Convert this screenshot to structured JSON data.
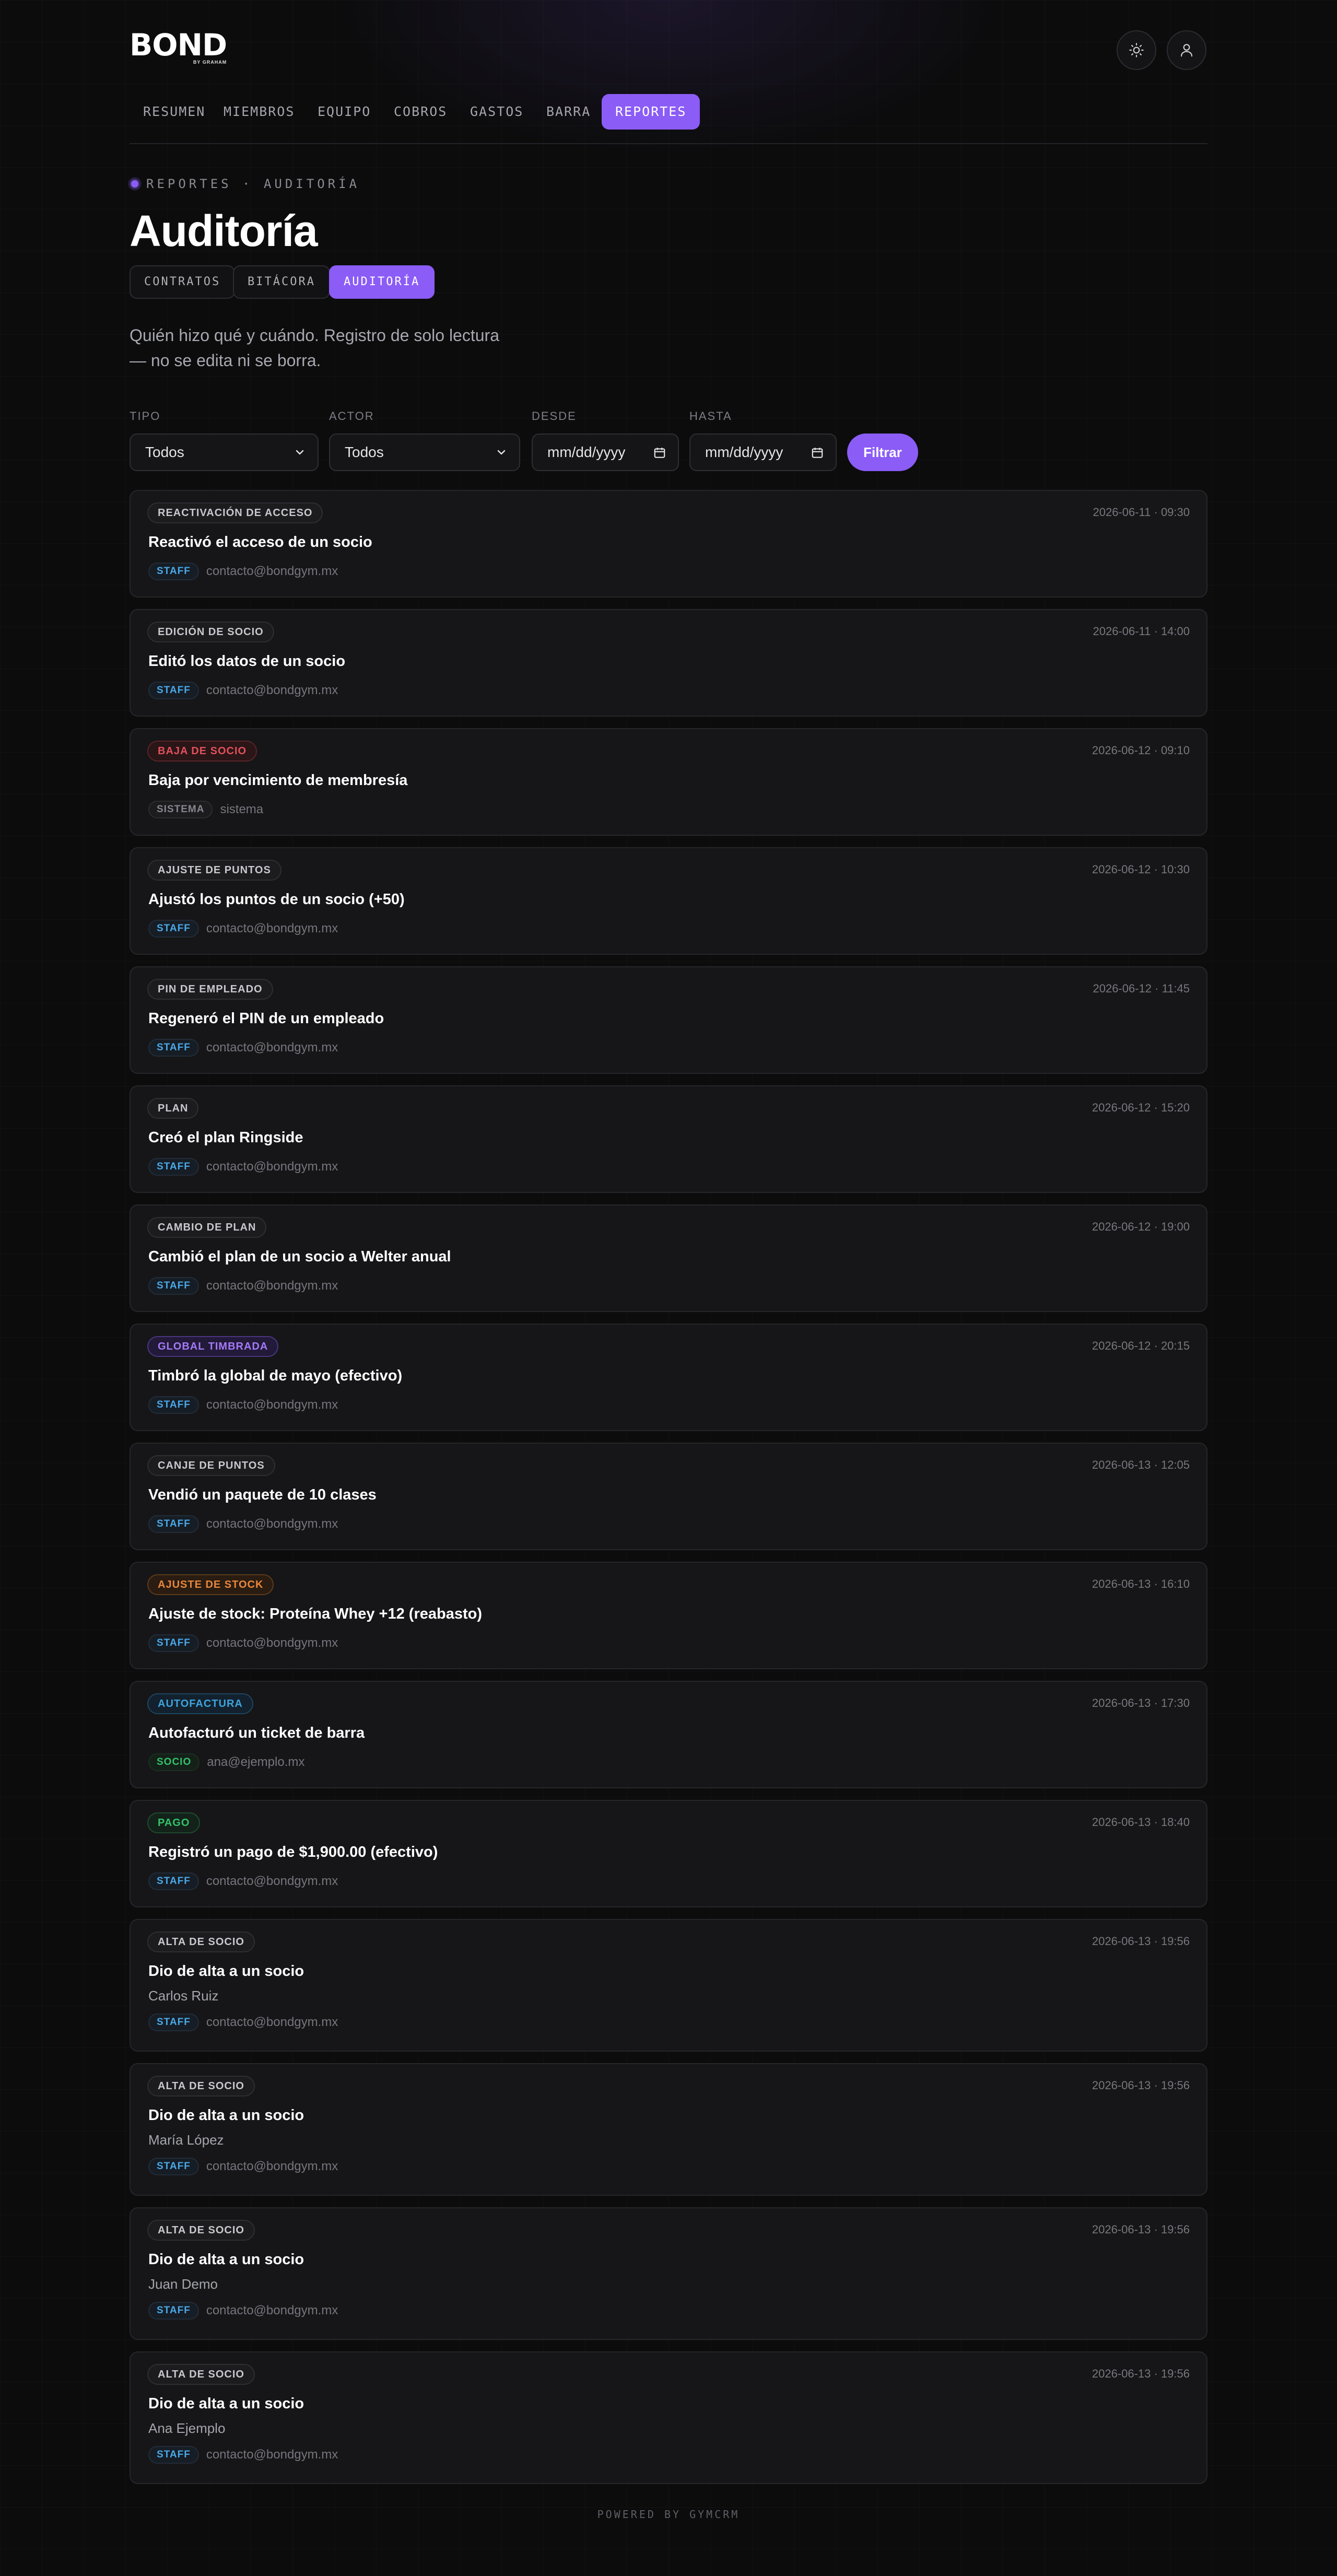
{
  "brand": {
    "logo_text": "BOND",
    "logo_sub": "BY GRAHAM"
  },
  "nav": [
    "RESUMEN",
    "MIEMBROS",
    "EQUIPO",
    "COBROS",
    "GASTOS",
    "BARRA",
    "REPORTES"
  ],
  "nav_active": "REPORTES",
  "breadcrumb": "REPORTES · AUDITORÍA",
  "page_title": "Auditoría",
  "subtabs": [
    "CONTRATOS",
    "BITÁCORA",
    "AUDITORÍA"
  ],
  "subtab_active": "AUDITORÍA",
  "description_line1": "Quién hizo qué y cuándo. Registro de solo lectura",
  "description_line2": "— no se edita ni se borra.",
  "filters": {
    "tipo_label": "TIPO",
    "tipo_value": "Todos",
    "actor_label": "ACTOR",
    "actor_value": "Todos",
    "desde_label": "DESDE",
    "desde_value": "mm/dd/yyyy",
    "hasta_label": "HASTA",
    "hasta_value": "mm/dd/yyyy",
    "button": "Filtrar"
  },
  "badge_colors": {
    "neutral": "#c8c8ce",
    "red": "#e0525c",
    "purple": "#a47af7",
    "orange": "#e8873c",
    "blue": "#3fa3dd",
    "green": "#34c26a"
  },
  "entries": [
    {
      "type": "REACTIVACIÓN DE ACCESO",
      "tone": "neutral",
      "time": "2026-06-11 · 09:30",
      "title": "Reactivó el acceso de un socio",
      "sub": "",
      "role": "STAFF",
      "role_kind": "staff",
      "actor": "contacto@bondgym.mx"
    },
    {
      "type": "EDICIÓN DE SOCIO",
      "tone": "neutral",
      "time": "2026-06-11 · 14:00",
      "title": "Editó los datos de un socio",
      "sub": "",
      "role": "STAFF",
      "role_kind": "staff",
      "actor": "contacto@bondgym.mx"
    },
    {
      "type": "BAJA DE SOCIO",
      "tone": "red",
      "time": "2026-06-12 · 09:10",
      "title": "Baja por vencimiento de membresía",
      "sub": "",
      "role": "SISTEMA",
      "role_kind": "sistema",
      "actor": "sistema"
    },
    {
      "type": "AJUSTE DE PUNTOS",
      "tone": "neutral",
      "time": "2026-06-12 · 10:30",
      "title": "Ajustó los puntos de un socio (+50)",
      "sub": "",
      "role": "STAFF",
      "role_kind": "staff",
      "actor": "contacto@bondgym.mx"
    },
    {
      "type": "PIN DE EMPLEADO",
      "tone": "neutral",
      "time": "2026-06-12 · 11:45",
      "title": "Regeneró el PIN de un empleado",
      "sub": "",
      "role": "STAFF",
      "role_kind": "staff",
      "actor": "contacto@bondgym.mx"
    },
    {
      "type": "PLAN",
      "tone": "neutral",
      "time": "2026-06-12 · 15:20",
      "title": "Creó el plan Ringside",
      "sub": "",
      "role": "STAFF",
      "role_kind": "staff",
      "actor": "contacto@bondgym.mx"
    },
    {
      "type": "CAMBIO DE PLAN",
      "tone": "neutral",
      "time": "2026-06-12 · 19:00",
      "title": "Cambió el plan de un socio a Welter anual",
      "sub": "",
      "role": "STAFF",
      "role_kind": "staff",
      "actor": "contacto@bondgym.mx"
    },
    {
      "type": "GLOBAL TIMBRADA",
      "tone": "purple",
      "time": "2026-06-12 · 20:15",
      "title": "Timbró la global de mayo (efectivo)",
      "sub": "",
      "role": "STAFF",
      "role_kind": "staff",
      "actor": "contacto@bondgym.mx"
    },
    {
      "type": "CANJE DE PUNTOS",
      "tone": "neutral",
      "time": "2026-06-13 · 12:05",
      "title": "Vendió un paquete de 10 clases",
      "sub": "",
      "role": "STAFF",
      "role_kind": "staff",
      "actor": "contacto@bondgym.mx"
    },
    {
      "type": "AJUSTE DE STOCK",
      "tone": "orange",
      "time": "2026-06-13 · 16:10",
      "title": "Ajuste de stock: Proteína Whey +12 (reabasto)",
      "sub": "",
      "role": "STAFF",
      "role_kind": "staff",
      "actor": "contacto@bondgym.mx"
    },
    {
      "type": "AUTOFACTURA",
      "tone": "blue",
      "time": "2026-06-13 · 17:30",
      "title": "Autofacturó un ticket de barra",
      "sub": "",
      "role": "SOCIO",
      "role_kind": "socio",
      "actor": "ana@ejemplo.mx"
    },
    {
      "type": "PAGO",
      "tone": "green",
      "time": "2026-06-13 · 18:40",
      "title": "Registró un pago de $1,900.00 (efectivo)",
      "sub": "",
      "role": "STAFF",
      "role_kind": "staff",
      "actor": "contacto@bondgym.mx"
    },
    {
      "type": "ALTA DE SOCIO",
      "tone": "neutral",
      "time": "2026-06-13 · 19:56",
      "title": "Dio de alta a un socio",
      "sub": "Carlos Ruiz",
      "role": "STAFF",
      "role_kind": "staff",
      "actor": "contacto@bondgym.mx"
    },
    {
      "type": "ALTA DE SOCIO",
      "tone": "neutral",
      "time": "2026-06-13 · 19:56",
      "title": "Dio de alta a un socio",
      "sub": "María López",
      "role": "STAFF",
      "role_kind": "staff",
      "actor": "contacto@bondgym.mx"
    },
    {
      "type": "ALTA DE SOCIO",
      "tone": "neutral",
      "time": "2026-06-13 · 19:56",
      "title": "Dio de alta a un socio",
      "sub": "Juan Demo",
      "role": "STAFF",
      "role_kind": "staff",
      "actor": "contacto@bondgym.mx"
    },
    {
      "type": "ALTA DE SOCIO",
      "tone": "neutral",
      "time": "2026-06-13 · 19:56",
      "title": "Dio de alta a un socio",
      "sub": "Ana Ejemplo",
      "role": "STAFF",
      "role_kind": "staff",
      "actor": "contacto@bondgym.mx"
    }
  ],
  "footer": "POWERED BY GYMCRM"
}
